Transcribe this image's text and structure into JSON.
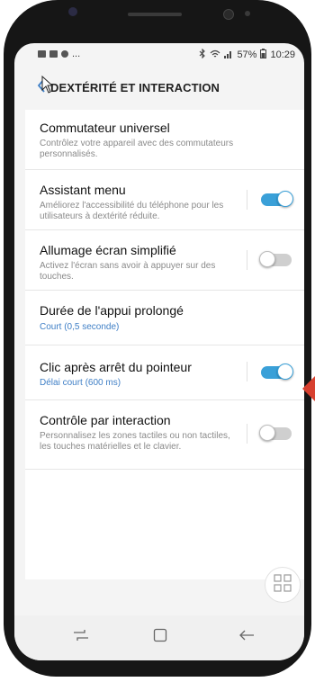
{
  "status_bar": {
    "left_dots": "...",
    "battery_percent": "57%",
    "time": "10:29",
    "icons": [
      "gallery-icon",
      "flipboard-icon",
      "person-icon",
      "bluetooth-icon",
      "wifi-icon",
      "signal-icon",
      "battery-icon"
    ]
  },
  "app_bar": {
    "title": "DEXTÉRITÉ ET INTERACTION",
    "back_icon": "chevron-left-icon"
  },
  "settings": [
    {
      "title": "Commutateur universel",
      "subtitle": "Contrôlez votre appareil avec des commutateurs personnalisés.",
      "has_toggle": false
    },
    {
      "title": "Assistant menu",
      "subtitle": "Améliorez l'accessibilité du téléphone pour les utilisateurs à dextérité réduite.",
      "has_toggle": true,
      "toggle_on": true
    },
    {
      "title": "Allumage écran simplifié",
      "subtitle": "Activez l'écran sans avoir à appuyer sur des touches.",
      "has_toggle": true,
      "toggle_on": false
    },
    {
      "title": "Durée de l'appui prolongé",
      "subtitle": "Court (0,5 seconde)",
      "subtitle_color": "#3f7fc6",
      "has_toggle": false
    },
    {
      "title": "Clic après arrêt du pointeur",
      "subtitle": "Délai court (600 ms)",
      "subtitle_color": "#3f7fc6",
      "has_toggle": true,
      "toggle_on": true
    },
    {
      "title": "Contrôle par interaction",
      "subtitle": "Personnalisez les zones tactiles ou non tactiles, les touches matérielles et le clavier.",
      "has_toggle": true,
      "toggle_on": false
    }
  ],
  "floating_button": {
    "icon": "grid-icon"
  },
  "nav_bar": {
    "icons": [
      "recents-icon",
      "home-icon",
      "back-arrow-icon"
    ]
  },
  "colors": {
    "accent": "#3aa0d8",
    "link_blue": "#3f7fc6",
    "side_marker": "#d7402f"
  }
}
